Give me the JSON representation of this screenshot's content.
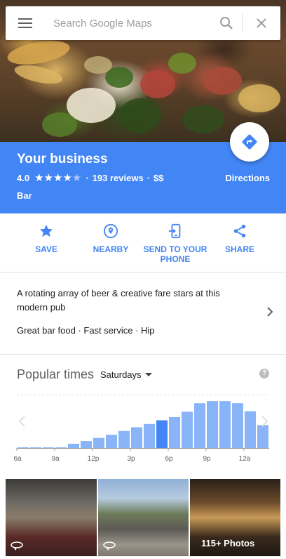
{
  "search": {
    "placeholder": "Search Google Maps"
  },
  "business": {
    "name": "Your business",
    "rating": "4.0",
    "rating_value": 4.0,
    "reviews": "193 reviews",
    "separator": "·",
    "price": "$$",
    "category": "Bar",
    "directions_label": "Directions"
  },
  "actions": [
    {
      "label": "SAVE",
      "icon": "star-icon"
    },
    {
      "label": "NEARBY",
      "icon": "nearby-icon"
    },
    {
      "label": "SEND TO YOUR PHONE",
      "icon": "send-to-phone-icon"
    },
    {
      "label": "SHARE",
      "icon": "share-icon"
    }
  ],
  "description": {
    "text": "A rotating array of beer & creative fare stars at this modern pub",
    "tags": "Great bar food · Fast service · Hip"
  },
  "popular_times": {
    "title": "Popular times",
    "day": "Saturdays"
  },
  "chart_data": {
    "type": "bar",
    "tick_labels": [
      "6a",
      "9a",
      "12p",
      "3p",
      "6p",
      "9p",
      "12a"
    ],
    "hours": [
      "6a",
      "7a",
      "8a",
      "9a",
      "10a",
      "11a",
      "12p",
      "1p",
      "2p",
      "3p",
      "4p",
      "5p",
      "6p",
      "7p",
      "8p",
      "9p",
      "10p",
      "11p",
      "12a",
      "1a"
    ],
    "values": [
      1,
      1,
      1,
      1,
      8,
      13,
      19,
      25,
      32,
      39,
      45,
      52,
      58,
      68,
      84,
      88,
      88,
      84,
      69,
      43
    ],
    "highlight_index": 11,
    "ylim": [
      0,
      100
    ],
    "colors": {
      "bar": "#8ab4f8",
      "highlight": "#4285f4"
    }
  },
  "photos": [
    {
      "name": "interior"
    },
    {
      "name": "street"
    },
    {
      "name": "bar",
      "label": "115+ Photos"
    }
  ],
  "colors": {
    "accent": "#4285f4",
    "header_bg": "#4285f4"
  }
}
